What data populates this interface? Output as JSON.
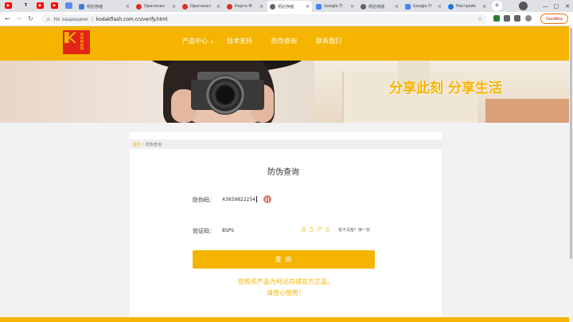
{
  "browser": {
    "tabs": [
      {
        "label": "柯达存储",
        "color": "#4a7bd0"
      },
      {
        "label": "Оригинал",
        "color": "#d93025"
      },
      {
        "label": "Оригинал",
        "color": "#d93025"
      },
      {
        "label": "Карта М",
        "color": "#d93025"
      },
      {
        "label": "柯达存储",
        "color": "#5f6368"
      },
      {
        "label": "Google П",
        "color": "#4285f4"
      },
      {
        "label": "柯达存储",
        "color": "#5f6368"
      },
      {
        "label": "Google П",
        "color": "#4285f4"
      },
      {
        "label": "Настройк",
        "color": "#1a73e8"
      }
    ],
    "active_tab_index": 4,
    "security_text": "Не защищено",
    "url": "kodakflash.com.cn/verify.html",
    "update_button": "Ошибка"
  },
  "site": {
    "logo_text": "KODAK",
    "nav": {
      "products": "产品中心",
      "support": "技术支持",
      "verify": "防伪查询",
      "contact": "联系我们"
    },
    "slogan": "分享此刻 分享生活"
  },
  "breadcrumb": {
    "home": "首页",
    "current": "防伪查询"
  },
  "form": {
    "title": "防伪查询",
    "code_label": "防伪码：",
    "code_value": "43659822254",
    "verify_label": "验证码：",
    "verify_value": "85PS",
    "captcha_chars": [
      "8",
      "5",
      "P",
      "S"
    ],
    "refresh_text": "看不清楚？换一张",
    "submit_label": "查 询"
  },
  "notice": {
    "line1": "您购买产品为柯达存储官方正品，",
    "line2": "请放心使用！"
  },
  "colors": {
    "brand_yellow": "#f5b400",
    "brand_red": "#e2231a"
  }
}
